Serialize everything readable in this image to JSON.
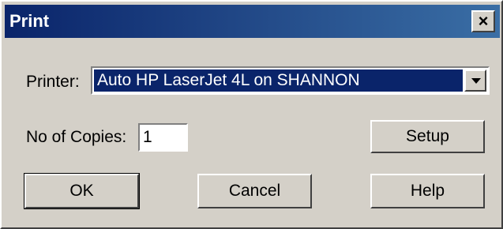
{
  "window": {
    "title": "Print",
    "close_symbol": "×",
    "close_icon": "close-icon"
  },
  "printer": {
    "label": "Printer:",
    "selected": "Auto HP LaserJet 4L on SHANNON",
    "dropdown_icon": "chevron-down-icon"
  },
  "copies": {
    "label": "No of Copies:",
    "value": "1"
  },
  "buttons": {
    "setup": "Setup",
    "ok": "OK",
    "cancel": "Cancel",
    "help": "Help"
  },
  "colors": {
    "titlebar_start": "#0a246a",
    "titlebar_end": "#3a6ea5",
    "face": "#d4d0c8",
    "selection": "#0a246a"
  }
}
